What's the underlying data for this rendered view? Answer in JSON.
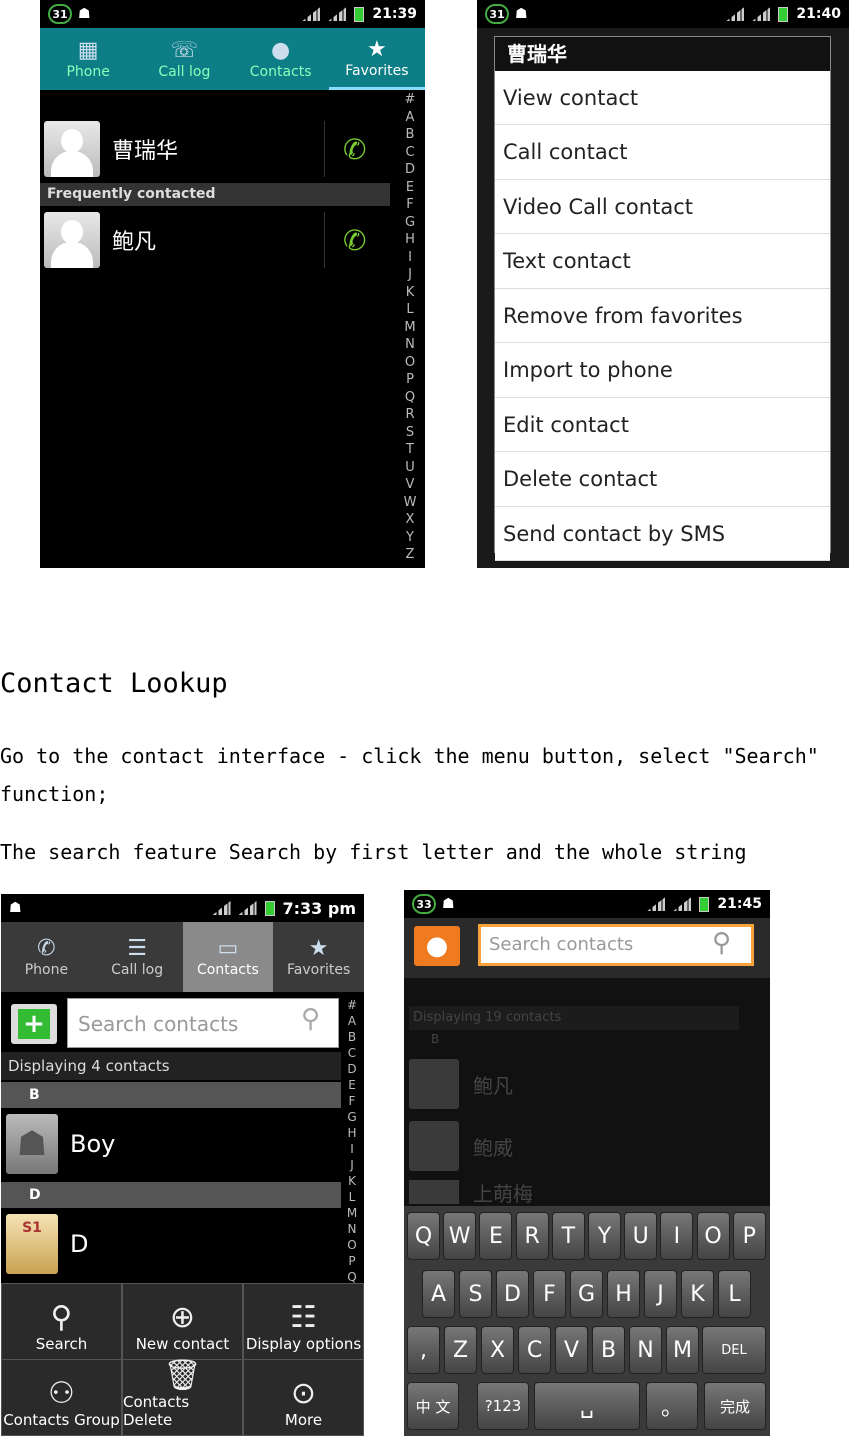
{
  "screen1": {
    "status": {
      "badge": "31",
      "time": "21:39"
    },
    "tabs": [
      {
        "label": "Phone",
        "icon": "dialpad-icon"
      },
      {
        "label": "Call log",
        "icon": "call-log-icon"
      },
      {
        "label": "Contacts",
        "icon": "contacts-icon"
      },
      {
        "label": "Favorites",
        "icon": "star-icon"
      }
    ],
    "favorite_name": "曹瑞华",
    "section_header": "Frequently contacted",
    "frequent_name": "鲍凡",
    "az_index": [
      "#",
      "A",
      "B",
      "C",
      "D",
      "E",
      "F",
      "G",
      "H",
      "I",
      "J",
      "K",
      "L",
      "M",
      "N",
      "O",
      "P",
      "Q",
      "R",
      "S",
      "T",
      "U",
      "V",
      "W",
      "X",
      "Y",
      "Z"
    ]
  },
  "screen2": {
    "status": {
      "badge": "31",
      "time": "21:40"
    },
    "menu_title": "曹瑞华",
    "menu_items": [
      "View contact",
      "Call contact",
      "Video Call contact",
      "Text contact",
      "Remove from favorites",
      "Import to phone",
      "Edit contact",
      "Delete contact",
      "Send contact by SMS"
    ]
  },
  "document": {
    "heading": "Contact Lookup",
    "para1_line1": "Go to the contact interface - click the menu button, select \"Search\"",
    "para1_line2": "function;",
    "para2": "The search feature Search by first letter and the whole string"
  },
  "screen3": {
    "status": {
      "time": "7:33 pm"
    },
    "tabs": [
      {
        "label": "Phone",
        "icon": "phone-icon"
      },
      {
        "label": "Call log",
        "icon": "call-log-icon"
      },
      {
        "label": "Contacts",
        "icon": "contacts-icon"
      },
      {
        "label": "Favorites",
        "icon": "star-icon"
      }
    ],
    "search_placeholder": "Search contacts",
    "count_text": "Displaying 4 contacts",
    "section_b": "B",
    "contact_boy": "Boy",
    "section_d": "D",
    "contact_d": "D",
    "sim_label": "S1",
    "menu": [
      "Search",
      "New contact",
      "Display options",
      "Contacts Group",
      "Contacts Delete",
      "More"
    ],
    "az_index": [
      "#",
      "A",
      "B",
      "C",
      "D",
      "E",
      "F",
      "G",
      "H",
      "I",
      "J",
      "K",
      "L",
      "M",
      "N",
      "O",
      "P",
      "Q"
    ]
  },
  "screen4": {
    "status": {
      "badge": "33",
      "time": "21:45"
    },
    "search_placeholder": "Search contacts",
    "bg_count": "Displaying 19 contacts",
    "bg_section": "B",
    "bg_names": [
      "鲍凡",
      "鲍威",
      "上萌梅"
    ],
    "keyboard": {
      "row1": [
        "Q",
        "W",
        "E",
        "R",
        "T",
        "Y",
        "U",
        "I",
        "O",
        "P"
      ],
      "row2": [
        "A",
        "S",
        "D",
        "F",
        "G",
        "H",
        "J",
        "K",
        "L"
      ],
      "row3": [
        ",",
        "Z",
        "X",
        "C",
        "V",
        "B",
        "N",
        "M"
      ],
      "del": "DEL",
      "row4": [
        "中 文",
        "?123",
        "␣",
        "。",
        "完成"
      ]
    }
  }
}
